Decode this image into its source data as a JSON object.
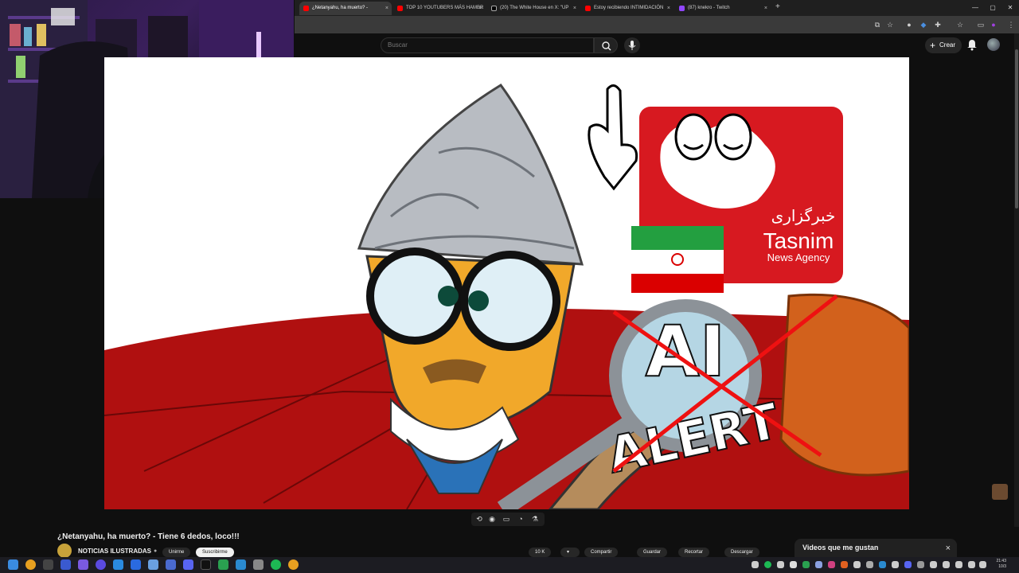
{
  "browser": {
    "tabs": [
      {
        "label": "¿Netanyahu, ha muerto? - ",
        "active": true,
        "icon": "youtube-icon"
      },
      {
        "label": "TOP 10 YOUTUBERS MÁS HAMBR",
        "active": false,
        "icon": "youtube-icon"
      },
      {
        "label": "(20) The White House en X: \"UP",
        "active": false,
        "icon": "x-icon"
      },
      {
        "label": "Estoy recibiendo INTIMIDACIÓN",
        "active": false,
        "icon": "youtube-icon"
      },
      {
        "label": "(87) knekro - Twitch",
        "active": false,
        "icon": "twitch-icon"
      }
    ],
    "new_tab": "+",
    "close": "×"
  },
  "youtube": {
    "search_placeholder": "Buscar",
    "create_label": "Crear",
    "video_title": "¿Netanyahu, ha muerto? - Tiene 6 dedos, loco!!!",
    "channel_name": "NOTICIAS ILUSTRADAS",
    "join_label": "Unirme",
    "subscribe_label": "Suscribirme",
    "action_labels": [
      "10 K",
      "Compartir",
      "Guardar",
      "Recortar",
      "Descargar"
    ],
    "liked_panel_title": "Videos que me gustan"
  },
  "video_frame": {
    "logo_farsi": "خبرگزاری",
    "logo_name": "Tasnim",
    "logo_sub": "News Agency",
    "alert_line1": "AI",
    "alert_line2": "ALERT"
  },
  "taskbar": {
    "time": "21:43",
    "date": "10/3"
  },
  "colors": {
    "youtube_red": "#ff0000",
    "background": "#0f0f0f",
    "tasnim_red": "#d71920",
    "couch_red": "#b01010"
  }
}
